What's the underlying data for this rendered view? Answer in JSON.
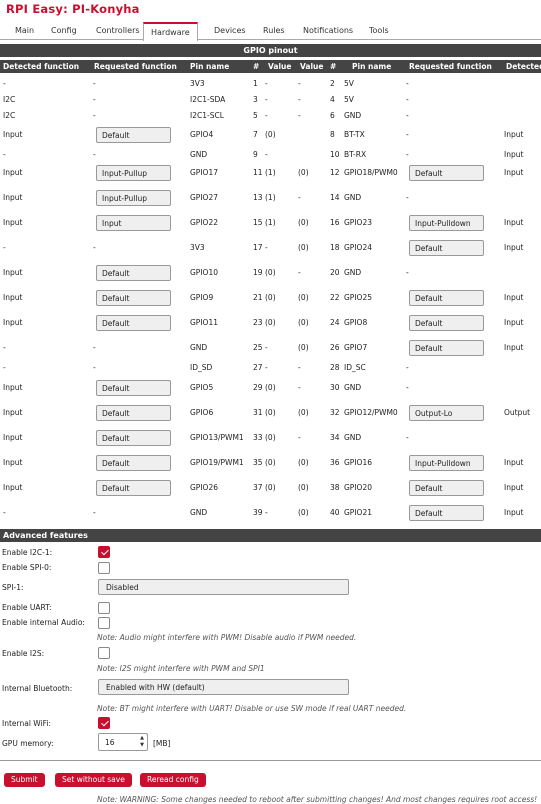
{
  "app": {
    "title": "RPI Easy: PI-Konyha"
  },
  "tabs": [
    "Main",
    "Config",
    "Controllers",
    "Hardware",
    "Devices",
    "Rules",
    "Notifications",
    "Tools"
  ],
  "gpio": {
    "title": "GPIO pinout",
    "headers": [
      "Detected function",
      "Requested function",
      "Pin name",
      "#",
      "Value",
      "Value",
      "#",
      "Pin name",
      "Requested function",
      "Detected"
    ],
    "rows": [
      {
        "ld": "-",
        "lr": "-",
        "lp": "3V3",
        "ln": "1",
        "lv": "-",
        "rv": "-",
        "rn": "2",
        "rp": "5V",
        "rr": "-",
        "rd": ""
      },
      {
        "ld": "I2C",
        "lr": "-",
        "lp": "I2C1-SDA",
        "ln": "3",
        "lv": "-",
        "rv": "-",
        "rn": "4",
        "rp": "5V",
        "rr": "-",
        "rd": ""
      },
      {
        "ld": "I2C",
        "lr": "-",
        "lp": "I2C1-SCL",
        "ln": "5",
        "lv": "-",
        "rv": "-",
        "rn": "6",
        "rp": "GND",
        "rr": "-",
        "rd": ""
      },
      {
        "ld": "Input",
        "lr": "Default",
        "lp": "GPIO4",
        "ln": "7",
        "lv": "(0)",
        "rv": "",
        "rn": "8",
        "rp": "BT-TX",
        "rr": "-",
        "rd": "Input"
      },
      {
        "ld": "-",
        "lr": "-",
        "lp": "GND",
        "ln": "9",
        "lv": "-",
        "rv": "",
        "rn": "10",
        "rp": "BT-RX",
        "rr": "-",
        "rd": "Input"
      },
      {
        "ld": "Input",
        "lr": "Input-Pullup",
        "lp": "GPIO17",
        "ln": "11",
        "lv": "(1)",
        "rv": "(0)",
        "rn": "12",
        "rp": "GPIO18/PWM0",
        "rr": "Default",
        "rd": "Input"
      },
      {
        "ld": "Input",
        "lr": "Input-Pullup",
        "lp": "GPIO27",
        "ln": "13",
        "lv": "(1)",
        "rv": "-",
        "rn": "14",
        "rp": "GND",
        "rr": "-",
        "rd": ""
      },
      {
        "ld": "Input",
        "lr": "Input",
        "lp": "GPIO22",
        "ln": "15",
        "lv": "(1)",
        "rv": "(0)",
        "rn": "16",
        "rp": "GPIO23",
        "rr": "Input-Pulldown",
        "rd": "Input"
      },
      {
        "ld": "-",
        "lr": "-",
        "lp": "3V3",
        "ln": "17",
        "lv": "-",
        "rv": "(0)",
        "rn": "18",
        "rp": "GPIO24",
        "rr": "Default",
        "rd": "Input"
      },
      {
        "ld": "Input",
        "lr": "Default",
        "lp": "GPIO10",
        "ln": "19",
        "lv": "(0)",
        "rv": "-",
        "rn": "20",
        "rp": "GND",
        "rr": "-",
        "rd": ""
      },
      {
        "ld": "Input",
        "lr": "Default",
        "lp": "GPIO9",
        "ln": "21",
        "lv": "(0)",
        "rv": "(0)",
        "rn": "22",
        "rp": "GPIO25",
        "rr": "Default",
        "rd": "Input"
      },
      {
        "ld": "Input",
        "lr": "Default",
        "lp": "GPIO11",
        "ln": "23",
        "lv": "(0)",
        "rv": "(0)",
        "rn": "24",
        "rp": "GPIO8",
        "rr": "Default",
        "rd": "Input"
      },
      {
        "ld": "-",
        "lr": "-",
        "lp": "GND",
        "ln": "25",
        "lv": "-",
        "rv": "(0)",
        "rn": "26",
        "rp": "GPIO7",
        "rr": "Default",
        "rd": "Input"
      },
      {
        "ld": "-",
        "lr": "-",
        "lp": "ID_SD",
        "ln": "27",
        "lv": "-",
        "rv": "-",
        "rn": "28",
        "rp": "ID_SC",
        "rr": "-",
        "rd": ""
      },
      {
        "ld": "Input",
        "lr": "Default",
        "lp": "GPIO5",
        "ln": "29",
        "lv": "(0)",
        "rv": "-",
        "rn": "30",
        "rp": "GND",
        "rr": "-",
        "rd": ""
      },
      {
        "ld": "Input",
        "lr": "Default",
        "lp": "GPIO6",
        "ln": "31",
        "lv": "(0)",
        "rv": "(0)",
        "rn": "32",
        "rp": "GPIO12/PWM0",
        "rr": "Output-Lo",
        "rd": "Output"
      },
      {
        "ld": "Input",
        "lr": "Default",
        "lp": "GPIO13/PWM1",
        "ln": "33",
        "lv": "(0)",
        "rv": "-",
        "rn": "34",
        "rp": "GND",
        "rr": "-",
        "rd": ""
      },
      {
        "ld": "Input",
        "lr": "Default",
        "lp": "GPIO19/PWM1",
        "ln": "35",
        "lv": "(0)",
        "rv": "(0)",
        "rn": "36",
        "rp": "GPIO16",
        "rr": "Input-Pulldown",
        "rd": "Input"
      },
      {
        "ld": "Input",
        "lr": "Default",
        "lp": "GPIO26",
        "ln": "37",
        "lv": "(0)",
        "rv": "(0)",
        "rn": "38",
        "rp": "GPIO20",
        "rr": "Default",
        "rd": "Input"
      },
      {
        "ld": "-",
        "lr": "-",
        "lp": "GND",
        "ln": "39",
        "lv": "-",
        "rv": "(0)",
        "rn": "40",
        "rp": "GPIO21",
        "rr": "Default",
        "rd": "Input"
      }
    ]
  },
  "advanced": {
    "title": "Advanced features",
    "i2c1_label": "Enable I2C-1:",
    "i2c1_checked": true,
    "spi0_label": "Enable SPI-0:",
    "spi0_checked": false,
    "spi1_label": "SPI-1:",
    "spi1_value": "Disabled",
    "uart_label": "Enable UART:",
    "uart_checked": false,
    "audio_label": "Enable internal Audio:",
    "audio_checked": false,
    "audio_note": "Note: Audio might interfere with PWM! Disable audio if PWM needed.",
    "i2s_label": "Enable I2S:",
    "i2s_checked": false,
    "i2s_note": "Note: I2S might interfere with PWM and SPI1",
    "bt_label": "Internal Bluetooth:",
    "bt_value": "Enabled with HW (default)",
    "bt_note": "Note: BT might interfere with UART! Disable or use SW mode if real UART needed.",
    "wifi_label": "Internal WiFi:",
    "wifi_checked": true,
    "gpu_label": "GPU memory:",
    "gpu_value": "16",
    "gpu_unit": "[MB]"
  },
  "buttons": {
    "submit": "Submit",
    "set_without_save": "Set without save",
    "reread": "Reread config"
  },
  "footer_note": "Note: WARNING: Some changes needed to reboot after submitting changes! And most changes requires root access!",
  "colors": {
    "accent": "#c8102e",
    "header_bg": "#444444"
  }
}
